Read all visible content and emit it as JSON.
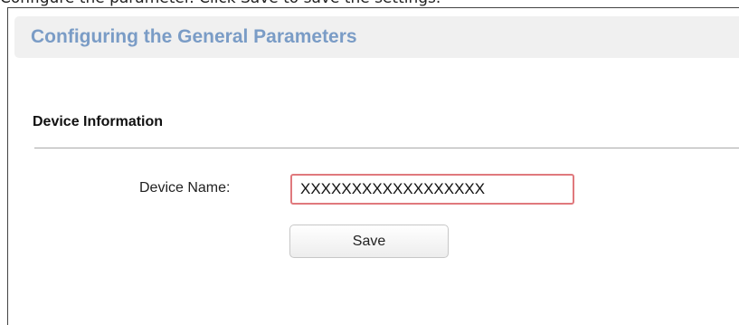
{
  "doc_text": {
    "instruction": "Configure the parameter. Click Save to save the settings."
  },
  "panel": {
    "title": "Configuring the General Parameters",
    "section_title": "Device Information",
    "device_name": {
      "label": "Device Name:",
      "value": "XXXXXXXXXXXXXXXXXX"
    },
    "save_label": "Save"
  },
  "colors": {
    "title_text": "#7a9cc6",
    "title_bar_bg": "#f0f0f0",
    "input_border_focus": "#e0797d",
    "divider": "#a9a9a9"
  }
}
